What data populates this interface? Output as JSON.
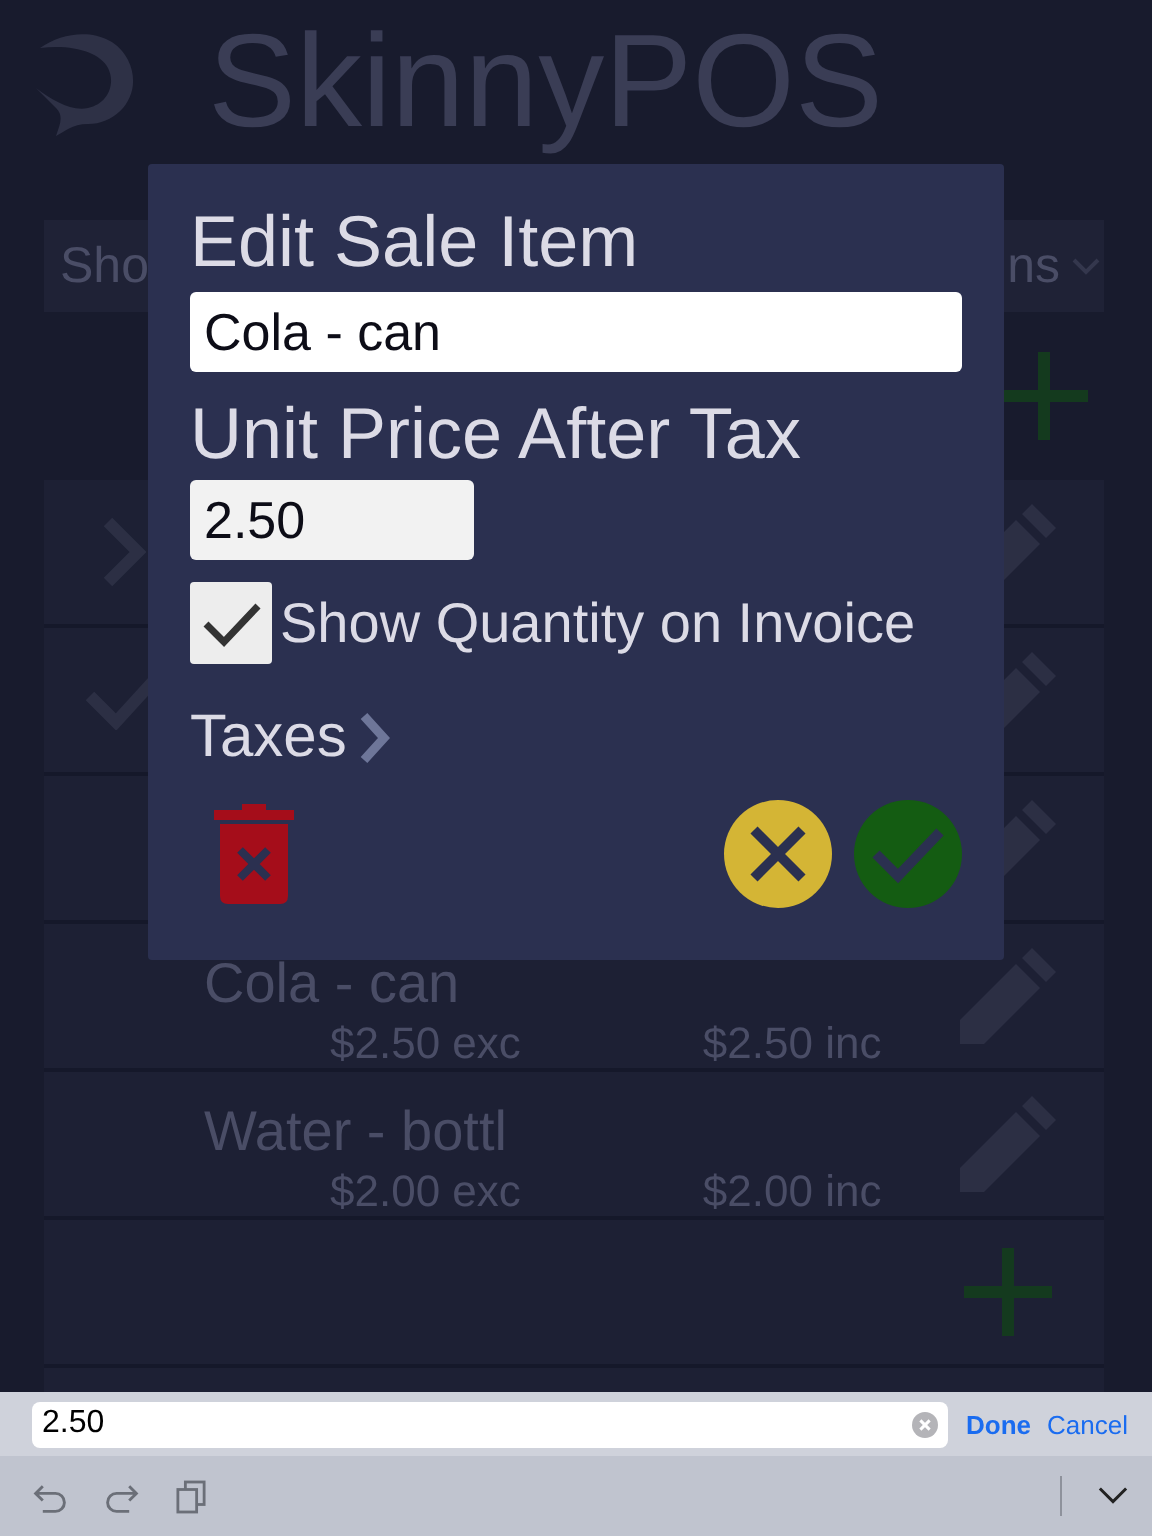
{
  "app": {
    "title": "SkinnyPOS"
  },
  "filter_dropdown": {
    "text_left": "Sho",
    "text_right": "ns"
  },
  "rows": [
    {
      "kind": "chevron"
    },
    {
      "kind": "check"
    },
    {
      "kind": "blank"
    },
    {
      "kind": "item",
      "name": "Cola - can",
      "price_exc": "$2.50 exc",
      "price_inc": "$2.50 inc"
    },
    {
      "kind": "item",
      "name": "Water - bottl",
      "price_exc": "$2.00 exc",
      "price_inc": "$2.00 inc"
    },
    {
      "kind": "add"
    }
  ],
  "dialog": {
    "title": "Edit Sale Item",
    "name_field": {
      "value": "Cola - can"
    },
    "price_label": "Unit Price After Tax",
    "price_field": {
      "value": "2.50"
    },
    "show_quantity": {
      "label": "Show Quantity on Invoice",
      "checked": true
    },
    "taxes_link": "Taxes"
  },
  "input_bar": {
    "field": {
      "value": "2.50"
    },
    "done": "Done",
    "cancel": "Cancel"
  }
}
